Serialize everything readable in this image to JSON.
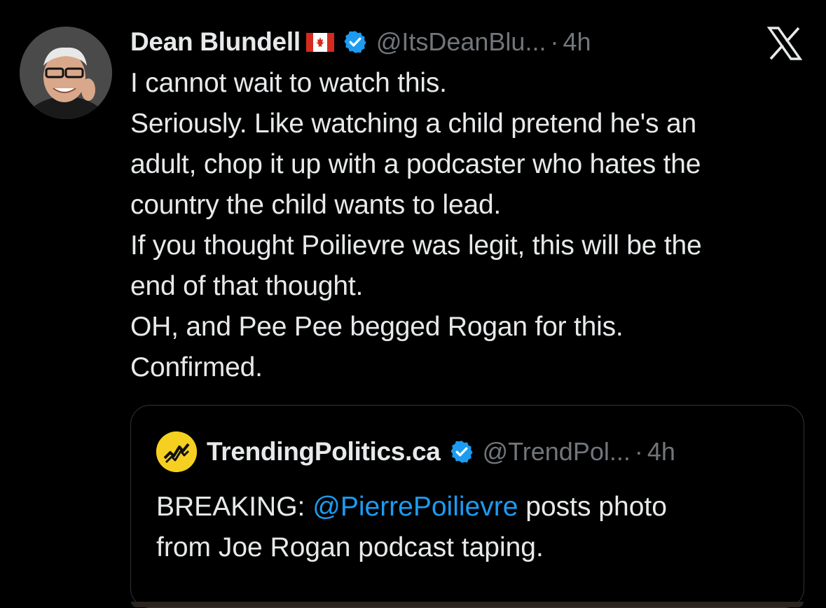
{
  "tweet": {
    "display_name": "Dean Blundell",
    "handle": "@ItsDeanBlu...",
    "separator": "·",
    "time": "4h",
    "lines": [
      "I cannot wait to watch this.",
      "Seriously. Like watching a child pretend he's an",
      "adult, chop it up with a podcaster who hates the",
      "country the child wants to lead.",
      "If you thought Poilievre was legit, this will be the",
      "end of that thought.",
      "OH, and Pee Pee begged Rogan for this.",
      "Confirmed."
    ]
  },
  "quote": {
    "display_name": "TrendingPolitics.ca",
    "handle": "@TrendPol...",
    "separator": "·",
    "time": "4h",
    "line1_prefix": "BREAKING: ",
    "mention": "@PierrePoilievre",
    "line1_suffix": " posts photo",
    "line2": "from Joe Rogan podcast taping."
  },
  "icons": {
    "flag": "canada-flag-icon",
    "verified": "verified-badge-icon",
    "brand": "x-logo-icon"
  },
  "colors": {
    "background": "#000000",
    "text": "#e7e9ea",
    "secondary": "#71767b",
    "accent": "#1d9bf0",
    "quote_border": "#2f3336"
  }
}
